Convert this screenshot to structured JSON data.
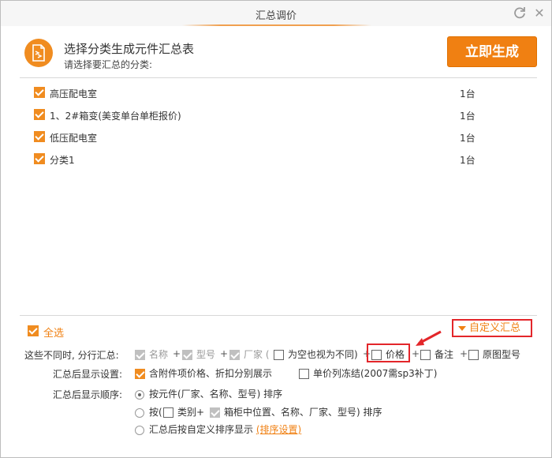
{
  "window": {
    "title": "汇总调价"
  },
  "header": {
    "title": "选择分类生成元件汇总表",
    "subtitle": "请选择要汇总的分类:",
    "generate_label": "立即生成"
  },
  "categories": [
    {
      "label": "高压配电室",
      "count": "1台",
      "checked": true
    },
    {
      "label": "1、2#箱变(美变单台单柜报价)",
      "count": "1台",
      "checked": true
    },
    {
      "label": "低压配电室",
      "count": "1台",
      "checked": true
    },
    {
      "label": "分类1",
      "count": "1台",
      "checked": true
    }
  ],
  "select_all": {
    "label": "全选",
    "checked": true
  },
  "custom_summary": {
    "label": "自定义汇总"
  },
  "group_row": {
    "label": "这些不同时, 分行汇总:",
    "name": "名称",
    "model": "型号",
    "vendor": "厂家 (",
    "empty_diff": "为空也视为不同)",
    "price": "价格",
    "remark": "备注",
    "original_model": "原图型号",
    "plus": "+"
  },
  "display_row": {
    "label": "汇总后显示设置:",
    "include_attach": "含附件项价格、折扣分别展示",
    "freeze_price": "单价列冻结(2007需sp3补丁)"
  },
  "order_row": {
    "label": "汇总后显示顺序:",
    "by_component": "按元件(厂家、名称、型号) 排序",
    "by_prefix": "按(",
    "by_category": "类别+",
    "by_position": "箱柜中位置、名称、厂家、型号) 排序",
    "by_custom": "汇总后按自定义排序显示",
    "sort_settings": "(排序设置)"
  },
  "colors": {
    "accent": "#f08012",
    "highlight": "#e3262a"
  }
}
